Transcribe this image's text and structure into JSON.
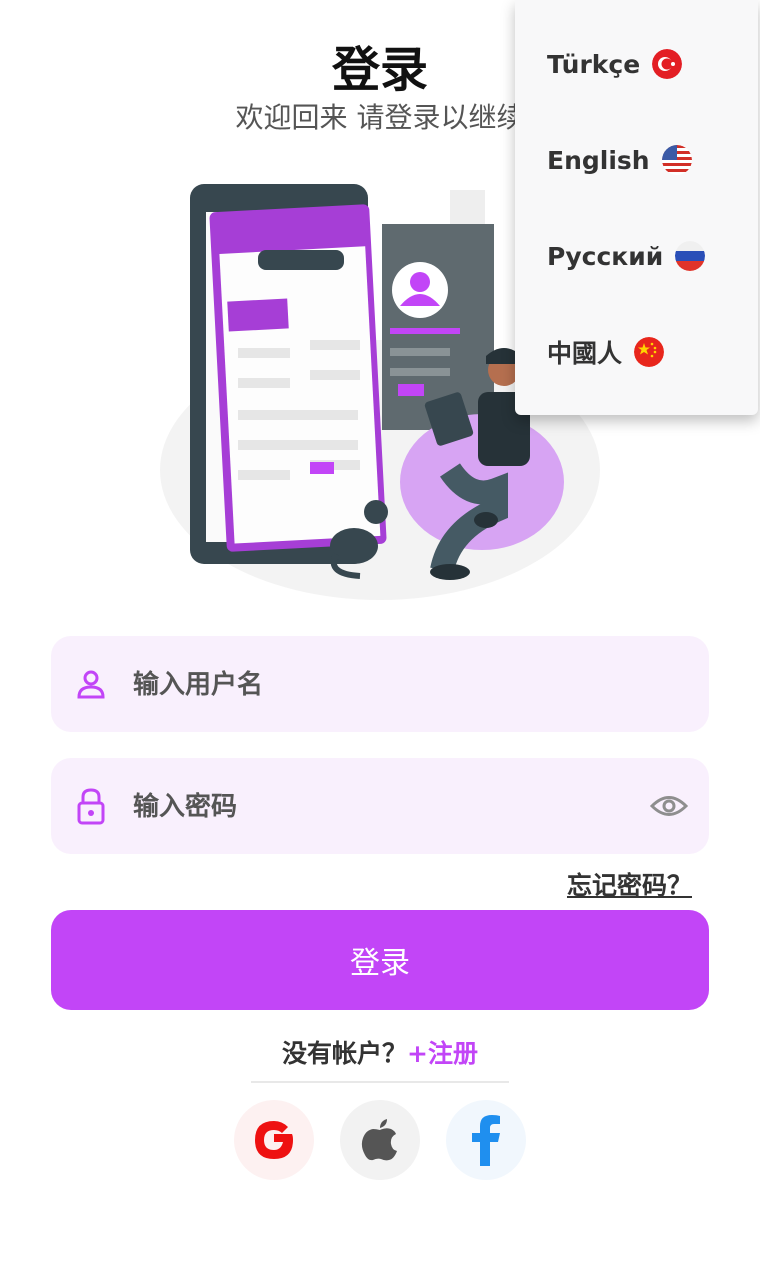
{
  "header": {
    "title": "登录",
    "subtitle": "欢迎回来 请登录以继续"
  },
  "form": {
    "username_placeholder": "输入用户名",
    "password_placeholder": "输入密码",
    "forgot_password": "忘记密码？",
    "login_label": "登录",
    "no_account": "没有帐户？",
    "register_link": "+注册"
  },
  "social": [
    {
      "name": "google",
      "icon": "google-icon"
    },
    {
      "name": "apple",
      "icon": "apple-icon"
    },
    {
      "name": "facebook",
      "icon": "facebook-icon"
    }
  ],
  "language_menu": {
    "items": [
      {
        "label": "Türkçe",
        "flag": "turkey-flag-icon"
      },
      {
        "label": "English",
        "flag": "us-flag-icon"
      },
      {
        "label": "Русский",
        "flag": "russia-flag-icon"
      },
      {
        "label": "中國人",
        "flag": "china-flag-icon"
      }
    ]
  },
  "colors": {
    "accent": "#c245f7",
    "field_bg": "#f9f0fd",
    "menu_bg": "#f8f8f9"
  }
}
